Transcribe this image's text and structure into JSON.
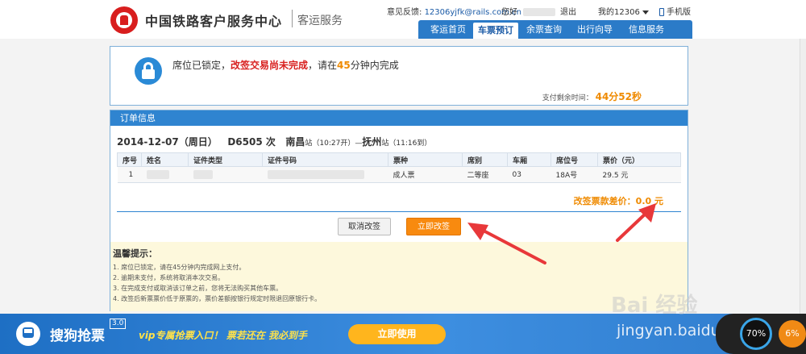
{
  "header": {
    "site_name": "中国铁路客户服务中心",
    "site_sub": "客运服务",
    "feedback_label": "意见反馈:",
    "feedback_email": "12306yjfk@rails.com.cn",
    "greeting": "您好",
    "logout": "退出",
    "my_account": "我的12306",
    "mobile": "手机版"
  },
  "nav": {
    "items": [
      "客运首页",
      "车票预订",
      "余票查询",
      "出行向导",
      "信息服务"
    ],
    "active": "车票预订"
  },
  "lock_notice": {
    "text1": "席位已锁定，",
    "text2": "改签交易尚未完成",
    "text3": "，请在",
    "minutes": "45",
    "text4": "分钟内完成",
    "remain_label": "支付剩余时间：",
    "remain_time": "44分52秒"
  },
  "order": {
    "title": "订单信息",
    "date": "2014-12-07（周日）",
    "train": "D6505 次",
    "from": "南昌",
    "from_suffix": "站（10:27开）—",
    "to": "抚州",
    "to_suffix": "站",
    "arrive": "（11:16到）",
    "columns": [
      "序号",
      "姓名",
      "证件类型",
      "证件号码",
      "票种",
      "席别",
      "车厢",
      "席位号",
      "票价（元）"
    ],
    "rows": [
      {
        "no": "1",
        "ticket_type": "成人票",
        "seat_class": "二等座",
        "coach": "03",
        "seat_no": "18A号",
        "price": "29.5 元"
      }
    ],
    "diff_label": "改签票款差价：",
    "diff_value": "0.0 元",
    "cancel_btn": "取消改签",
    "confirm_btn": "立即改签"
  },
  "tips": {
    "title": "温馨提示：",
    "items": [
      "1.  席位已锁定，请在45分钟内完成网上支付。",
      "2.  逾期未支付，系统将取消本次交易。",
      "3.  在完成支付或取消该订单之前，您将无法购买其他车票。",
      "4.  改签后新票票价低于原票的，票价差额按银行规定时限退回原银行卡。"
    ]
  },
  "bottom_bar": {
    "brand": "搜狗抢票",
    "version": "3.0",
    "slogan": "vip专属抢票入口！  票若还在 我必到手",
    "use_button": "立即使用",
    "watermark_big": "Bai 经验",
    "watermark": "jingyan.baidu.com",
    "speed_percent": "70%",
    "speed_alt": "6%"
  },
  "colors": {
    "accent_blue": "#2f84d0",
    "warning_red": "#d8201f",
    "orange": "#ef8a00",
    "arrow_red": "#e8383a"
  }
}
